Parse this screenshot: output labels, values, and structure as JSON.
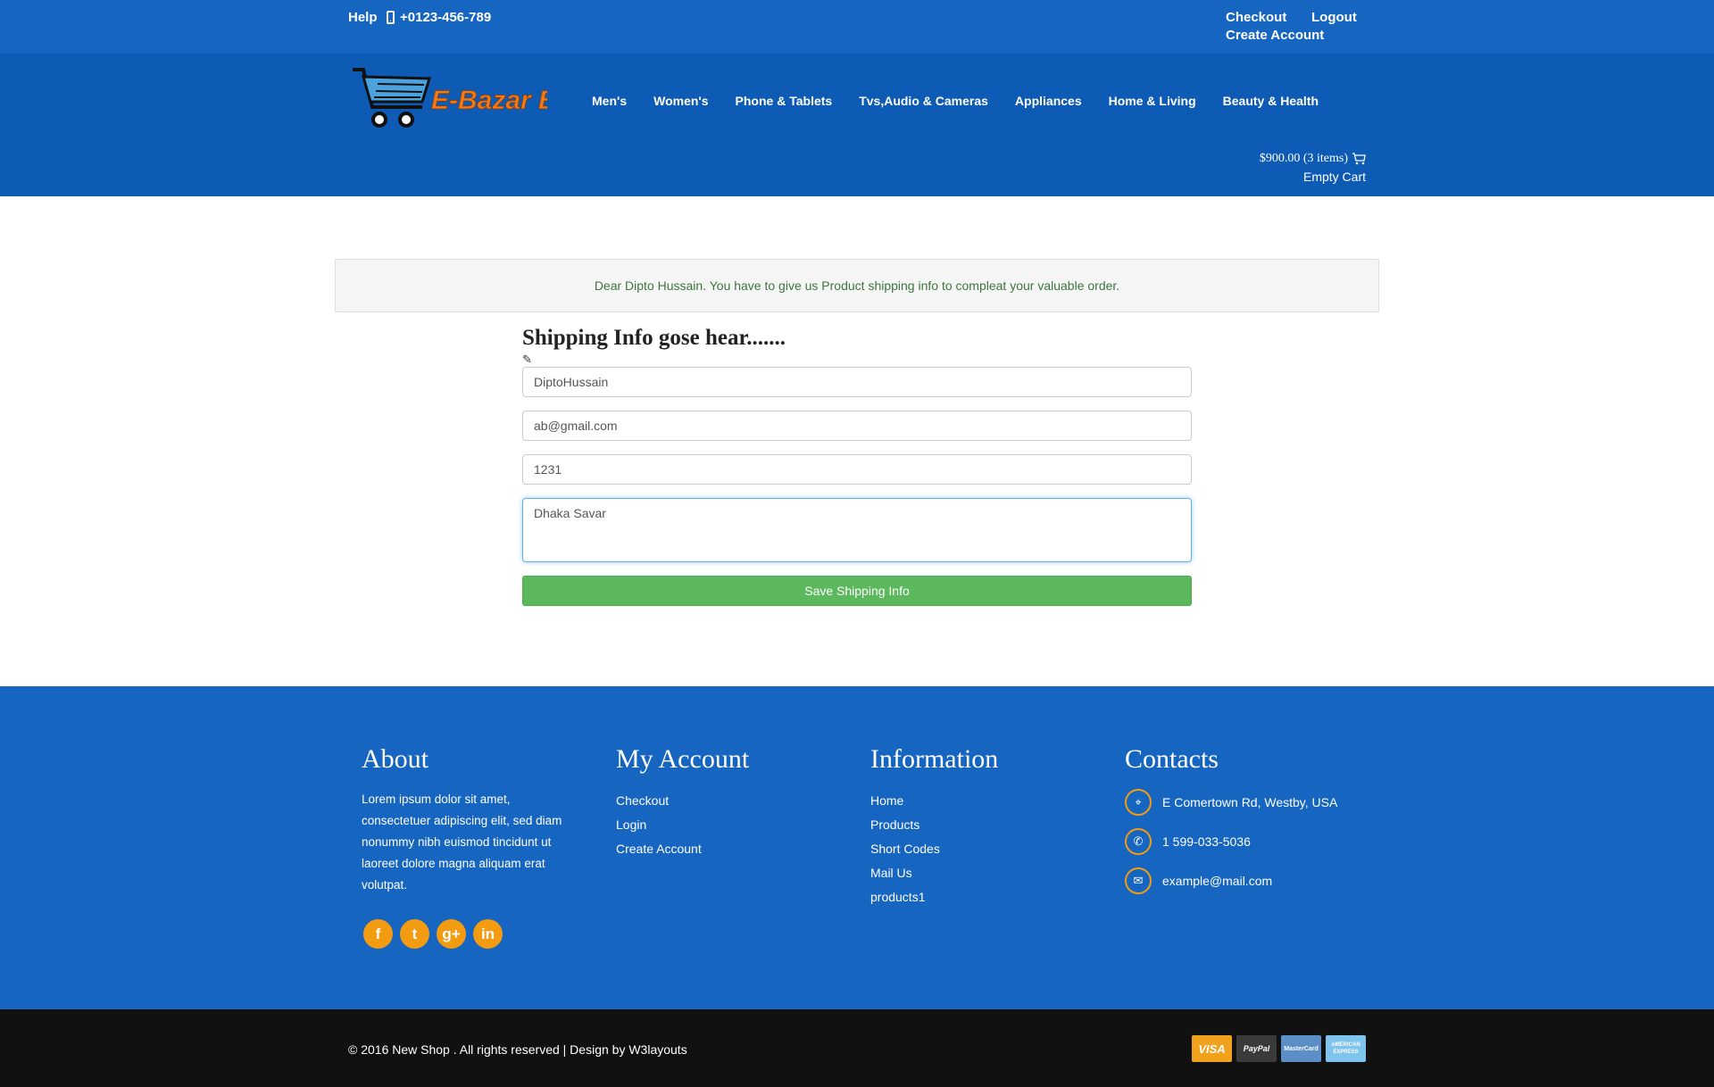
{
  "topbar": {
    "help": "Help",
    "phone": "+0123-456-789",
    "checkout": "Checkout",
    "logout": "Logout",
    "create_account": "Create Account"
  },
  "header": {
    "logo_text": "E-Bazar BD",
    "nav": [
      "Men's",
      "Women's",
      "Phone & Tablets",
      "Tvs,Audio & Cameras",
      "Appliances",
      "Home & Living",
      "Beauty & Health"
    ],
    "cart_total": "$900.00 (3 items)",
    "empty_cart": "Empty Cart"
  },
  "alert": {
    "message": "Dear Dipto Hussain. You have to give us Product shipping info to compleat your valuable order."
  },
  "form": {
    "title": "Shipping Info gose hear.......",
    "name_value": "DiptoHussain",
    "email_value": "ab@gmail.com",
    "phone_value": "1231",
    "address_value": "Dhaka Savar",
    "submit_label": "Save Shipping Info"
  },
  "footer": {
    "about": {
      "title": "About",
      "text": "Lorem ipsum dolor sit amet, consectetuer adipiscing elit, sed diam nonummy nibh euismod tincidunt ut laoreet dolore magna aliquam erat volutpat."
    },
    "my_account": {
      "title": "My Account",
      "links": [
        "Checkout",
        "Login",
        "Create Account"
      ]
    },
    "information": {
      "title": "Information",
      "links": [
        "Home",
        "Products",
        "Short Codes",
        "Mail Us",
        "products1"
      ]
    },
    "contacts": {
      "title": "Contacts",
      "address": "E Comertown Rd, Westby, USA",
      "phone": "1 599-033-5036",
      "email": "example@mail.com"
    }
  },
  "bottom": {
    "copyright": "© 2016 New Shop . All rights reserved | Design by  W3layouts",
    "cards": [
      "VISA",
      "PayPal",
      "MasterCard",
      "AMERICAN EXPRESS"
    ]
  },
  "colors": {
    "topbar": "#1665c0",
    "header": "#0d5bb5",
    "accent": "#f39c12",
    "button": "#5cb85c"
  }
}
